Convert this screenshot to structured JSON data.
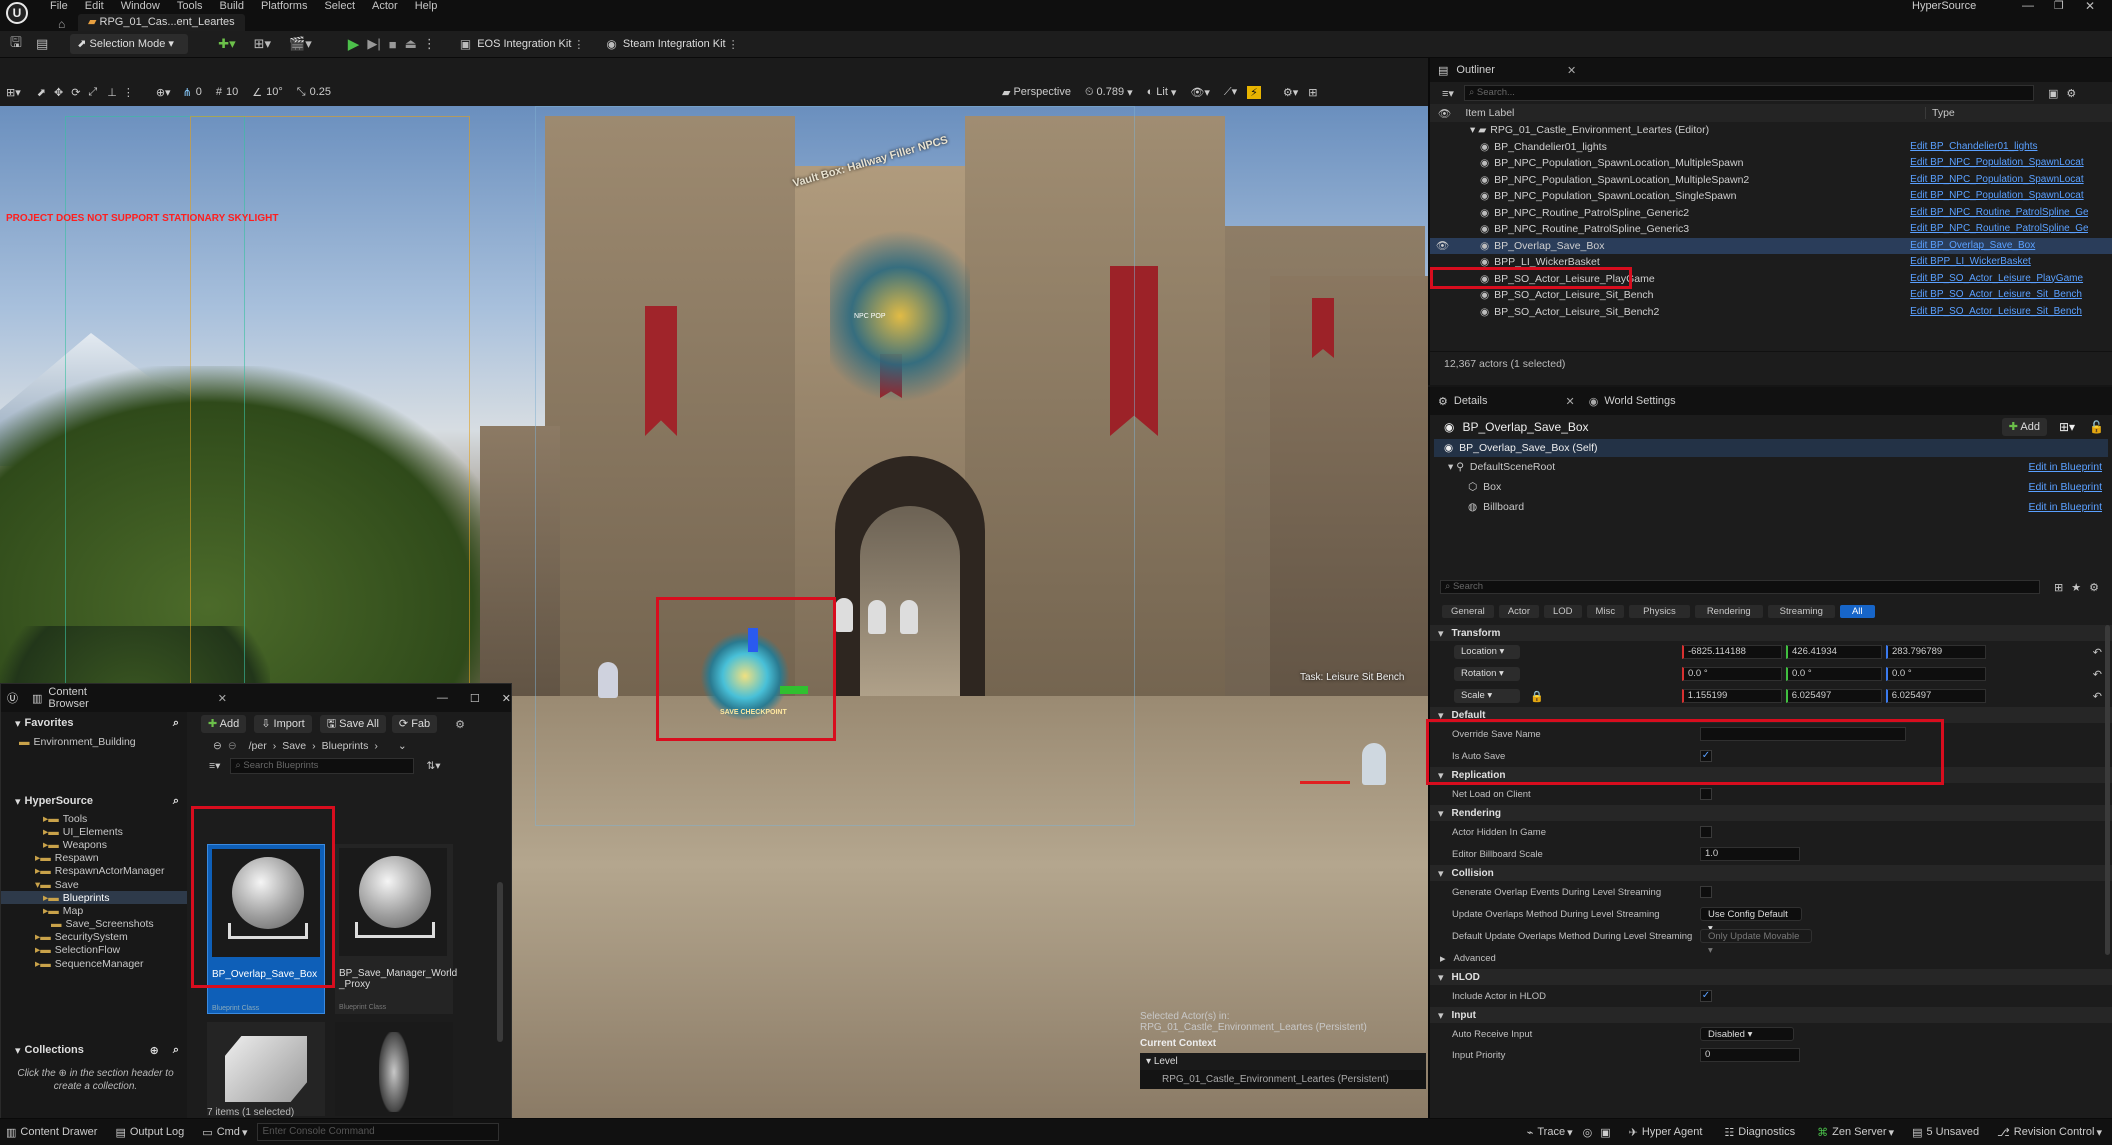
{
  "menubar": {
    "items": [
      "File",
      "Edit",
      "Window",
      "Tools",
      "Build",
      "Platforms",
      "Select",
      "Actor",
      "Help"
    ],
    "project_name": "HyperSource",
    "level_tab": "RPG_01_Cas...ent_Leartes"
  },
  "toolbar": {
    "mode_label": "Selection Mode",
    "eos_label": "EOS Integration Kit",
    "steam_label": "Steam Integration Kit"
  },
  "viewport": {
    "perspective_label": "Perspective",
    "speed_value": "0.789",
    "lit_label": "Lit",
    "snap_translate": "0",
    "grid_size": "10",
    "rot_snap": "10°",
    "scale_snap": "0.25",
    "warning_text": "PROJECT DOES NOT SUPPORT STATIONARY SKYLIGHT",
    "npc_label": "Vault Box: Hallway Filler NPCS",
    "npc_pop_label": "NPC POP",
    "checkpoint_label": "SAVE CHECKPOINT",
    "task_label": "Task: Leisure Sit Bench",
    "selected_actors_title": "Selected Actor(s) in:",
    "selected_actors_level": "RPG_01_Castle_Environment_Leartes (Persistent)",
    "current_context_label": "Current Context",
    "level_label": "Level",
    "level_value": "RPG_01_Castle_Environment_Leartes (Persistent)"
  },
  "outliner": {
    "title": "Outliner",
    "search_placeholder": "Search...",
    "col_item": "Item Label",
    "col_type": "Type",
    "root": "RPG_01_Castle_Environment_Leartes (Editor)",
    "rows": [
      {
        "label": "BP_Chandelier01_lights",
        "type": "Edit BP_Chandelier01_lights"
      },
      {
        "label": "BP_NPC_Population_SpawnLocation_MultipleSpawn",
        "type": "Edit BP_NPC_Population_SpawnLocat"
      },
      {
        "label": "BP_NPC_Population_SpawnLocation_MultipleSpawn2",
        "type": "Edit BP_NPC_Population_SpawnLocat"
      },
      {
        "label": "BP_NPC_Population_SpawnLocation_SingleSpawn",
        "type": "Edit BP_NPC_Population_SpawnLocat"
      },
      {
        "label": "BP_NPC_Routine_PatrolSpline_Generic2",
        "type": "Edit BP_NPC_Routine_PatrolSpline_Ge"
      },
      {
        "label": "BP_NPC_Routine_PatrolSpline_Generic3",
        "type": "Edit BP_NPC_Routine_PatrolSpline_Ge"
      },
      {
        "label": "BP_Overlap_Save_Box",
        "type": "Edit BP_Overlap_Save_Box"
      },
      {
        "label": "BPP_LI_WickerBasket",
        "type": "Edit BPP_LI_WickerBasket"
      },
      {
        "label": "BP_SO_Actor_Leisure_PlayGame",
        "type": "Edit BP_SO_Actor_Leisure_PlayGame"
      },
      {
        "label": "BP_SO_Actor_Leisure_Sit_Bench",
        "type": "Edit BP_SO_Actor_Leisure_Sit_Bench"
      },
      {
        "label": "BP_SO_Actor_Leisure_Sit_Bench2",
        "type": "Edit BP_SO_Actor_Leisure_Sit_Bench"
      }
    ],
    "footer": "12,367 actors (1 selected)"
  },
  "details": {
    "tab_details": "Details",
    "tab_world": "World Settings",
    "actor_name": "BP_Overlap_Save_Box",
    "add_label": "Add",
    "components": [
      {
        "label": "BP_Overlap_Save_Box (Self)",
        "link": ""
      },
      {
        "label": "DefaultSceneRoot",
        "link": "Edit in Blueprint"
      },
      {
        "label": "Box",
        "link": "Edit in Blueprint"
      },
      {
        "label": "Billboard",
        "link": "Edit in Blueprint"
      }
    ],
    "search_placeholder": "Search",
    "filters": [
      "General",
      "Actor",
      "LOD",
      "Misc",
      "Physics",
      "Rendering",
      "Streaming",
      "All"
    ],
    "transform_header": "Transform",
    "location_label": "Location",
    "rotation_label": "Rotation",
    "scale_label": "Scale",
    "location": [
      "-6825.114188",
      "426.41934",
      "283.796789"
    ],
    "rotation": [
      "0.0 °",
      "0.0 °",
      "0.0 °"
    ],
    "scale": [
      "1.155199",
      "6.025497",
      "6.025497"
    ],
    "default_header": "Default",
    "override_save_name": "Override Save Name",
    "is_auto_save": "Is Auto Save",
    "replication_header": "Replication",
    "net_load": "Net Load on Client",
    "rendering_header": "Rendering",
    "actor_hidden": "Actor Hidden In Game",
    "billboard_scale_label": "Editor Billboard Scale",
    "billboard_scale_value": "1.0",
    "collision_header": "Collision",
    "gen_overlap": "Generate Overlap Events During Level Streaming",
    "update_overlaps": "Update Overlaps Method During Level Streaming",
    "update_overlaps_value": "Use Config Default",
    "default_update": "Default Update Overlaps Method During Level Streaming",
    "default_update_value": "Only Update Movable",
    "advanced": "Advanced",
    "hlod_header": "HLOD",
    "include_hlod": "Include Actor in HLOD",
    "input_header": "Input",
    "auto_receive": "Auto Receive Input",
    "auto_receive_value": "Disabled",
    "input_priority": "Input Priority",
    "input_priority_value": "0"
  },
  "content_browser": {
    "title": "Content Browser",
    "add": "Add",
    "import": "Import",
    "save_all": "Save All",
    "fab": "Fab",
    "path": [
      "/per",
      "Save",
      "Blueprints"
    ],
    "search_placeholder": "Search Blueprints",
    "favorites": "Favorites",
    "favorite_item": "Environment_Building",
    "root": "HyperSource",
    "tree": [
      "Tools",
      "UI_Elements",
      "Weapons",
      "Respawn",
      "RespawnActorManager",
      "Save",
      "Blueprints",
      "Map",
      "Save_Screenshots",
      "SecuritySystem",
      "SelectionFlow",
      "SequenceManager"
    ],
    "collections": "Collections",
    "collections_hint_a": "Click the",
    "collections_hint_b": "in the section header to create a collection.",
    "assets": [
      {
        "name": "BP_Overlap_Save_Box",
        "type": "Blueprint Class"
      },
      {
        "name": "BP_Save_Manager_World _Proxy",
        "type": "Blueprint Class"
      }
    ],
    "status": "7 items (1 selected)"
  },
  "statusbar": {
    "content_drawer": "Content Drawer",
    "output_log": "Output Log",
    "cmd": "Cmd",
    "console_placeholder": "Enter Console Command",
    "trace": "Trace",
    "hyper_agent": "Hyper Agent",
    "diagnostics": "Diagnostics",
    "zen_server": "Zen Server",
    "unsaved": "5 Unsaved",
    "revision": "Revision Control"
  },
  "colors": {
    "accent_blue": "#0e5fb8",
    "selection_red": "#d80d1e",
    "link_blue": "#5aa0ff"
  }
}
